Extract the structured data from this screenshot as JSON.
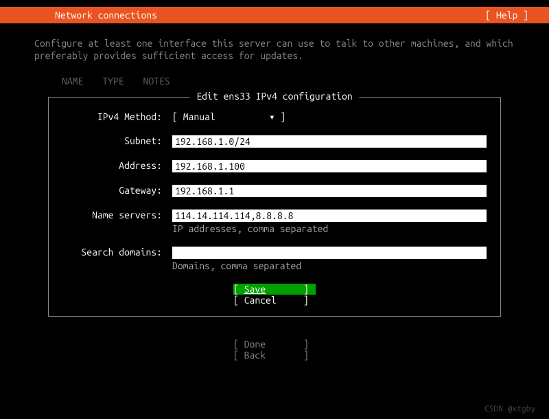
{
  "header": {
    "title": "Network connections",
    "help": "[ Help ]"
  },
  "description": "Configure at least one interface this server can use to talk to other machines, and which preferably provides sufficient access for updates.",
  "columns": {
    "name": "NAME",
    "type": "TYPE",
    "notes": "NOTES"
  },
  "box": {
    "title": "Edit ens33 IPv4 configuration",
    "method_label": "IPv4 Method:",
    "method_value": "Manual",
    "fields": {
      "subnet": {
        "label": "Subnet:",
        "value": "192.168.1.0/24"
      },
      "address": {
        "label": "Address:",
        "value": "192.168.1.100"
      },
      "gateway": {
        "label": "Gateway:",
        "value": "192.168.1.1"
      },
      "nameservers": {
        "label": "Name servers:",
        "value": "114.14.114.114,8.8.8.8",
        "hint": "IP addresses, comma separated"
      },
      "searchdomains": {
        "label": "Search domains:",
        "value": "",
        "hint": "Domains, comma separated"
      }
    },
    "save": "Save",
    "cancel": "Cancel"
  },
  "bottom": {
    "done": "Done",
    "back": "Back"
  },
  "watermark": "CSDN @xtgby"
}
